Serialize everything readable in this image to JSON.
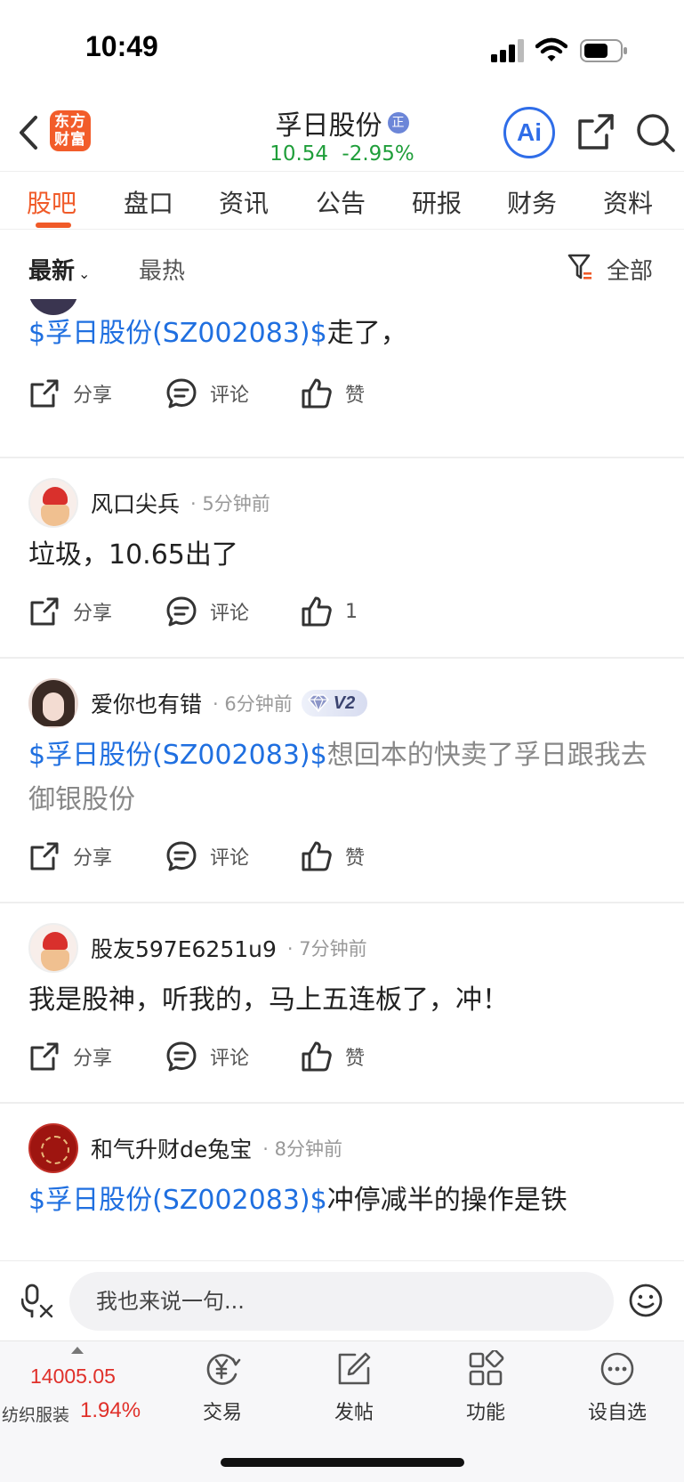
{
  "status_bar": {
    "time": "10:49"
  },
  "header": {
    "logo_line1": "东方",
    "logo_line2": "财富",
    "stock_name": "孚日股份",
    "badge": "正",
    "price": "10.54",
    "change": "-2.95%",
    "ai_label": "Ai"
  },
  "tabs": [
    "股吧",
    "盘口",
    "资讯",
    "公告",
    "研报",
    "财务",
    "资料"
  ],
  "filter": {
    "latest": "最新",
    "hot": "最热",
    "all": "全部"
  },
  "posts": [
    {
      "tag": "$孚日股份(SZ002083)$",
      "text": "走了，",
      "actions": {
        "share": "分享",
        "comment": "评论",
        "like": "赞"
      }
    },
    {
      "username": "风口尖兵",
      "time": "· 5分钟前",
      "text": "垃圾，10.65出了",
      "actions": {
        "share": "分享",
        "comment": "评论",
        "like": "1"
      }
    },
    {
      "username": "爱你也有错",
      "time": "· 6分钟前",
      "level": "V2",
      "tag": "$孚日股份(SZ002083)$",
      "text": "想回本的快卖了孚日跟我去御银股份",
      "actions": {
        "share": "分享",
        "comment": "评论",
        "like": "赞"
      }
    },
    {
      "username": "股友597E6251u9",
      "time": "· 7分钟前",
      "text": "我是股神，听我的，马上五连板了，冲！",
      "actions": {
        "share": "分享",
        "comment": "评论",
        "like": "赞"
      }
    },
    {
      "username": "和气升财de兔宝",
      "time": "· 8分钟前",
      "tag": "$孚日股份(SZ002083)$",
      "text": "冲停减半的操作是铁"
    }
  ],
  "comment_bar": {
    "placeholder": "我也来说一句..."
  },
  "bottom_bar": {
    "index_value": "14005.05",
    "index_name": "纺织服装",
    "index_change": "1.94%",
    "nav": [
      "交易",
      "发帖",
      "功能",
      "设自选"
    ]
  },
  "colors": {
    "accent": "#f05a28",
    "link": "#1f6fe0",
    "up": "#e0302a",
    "down": "#1f9e3a"
  }
}
